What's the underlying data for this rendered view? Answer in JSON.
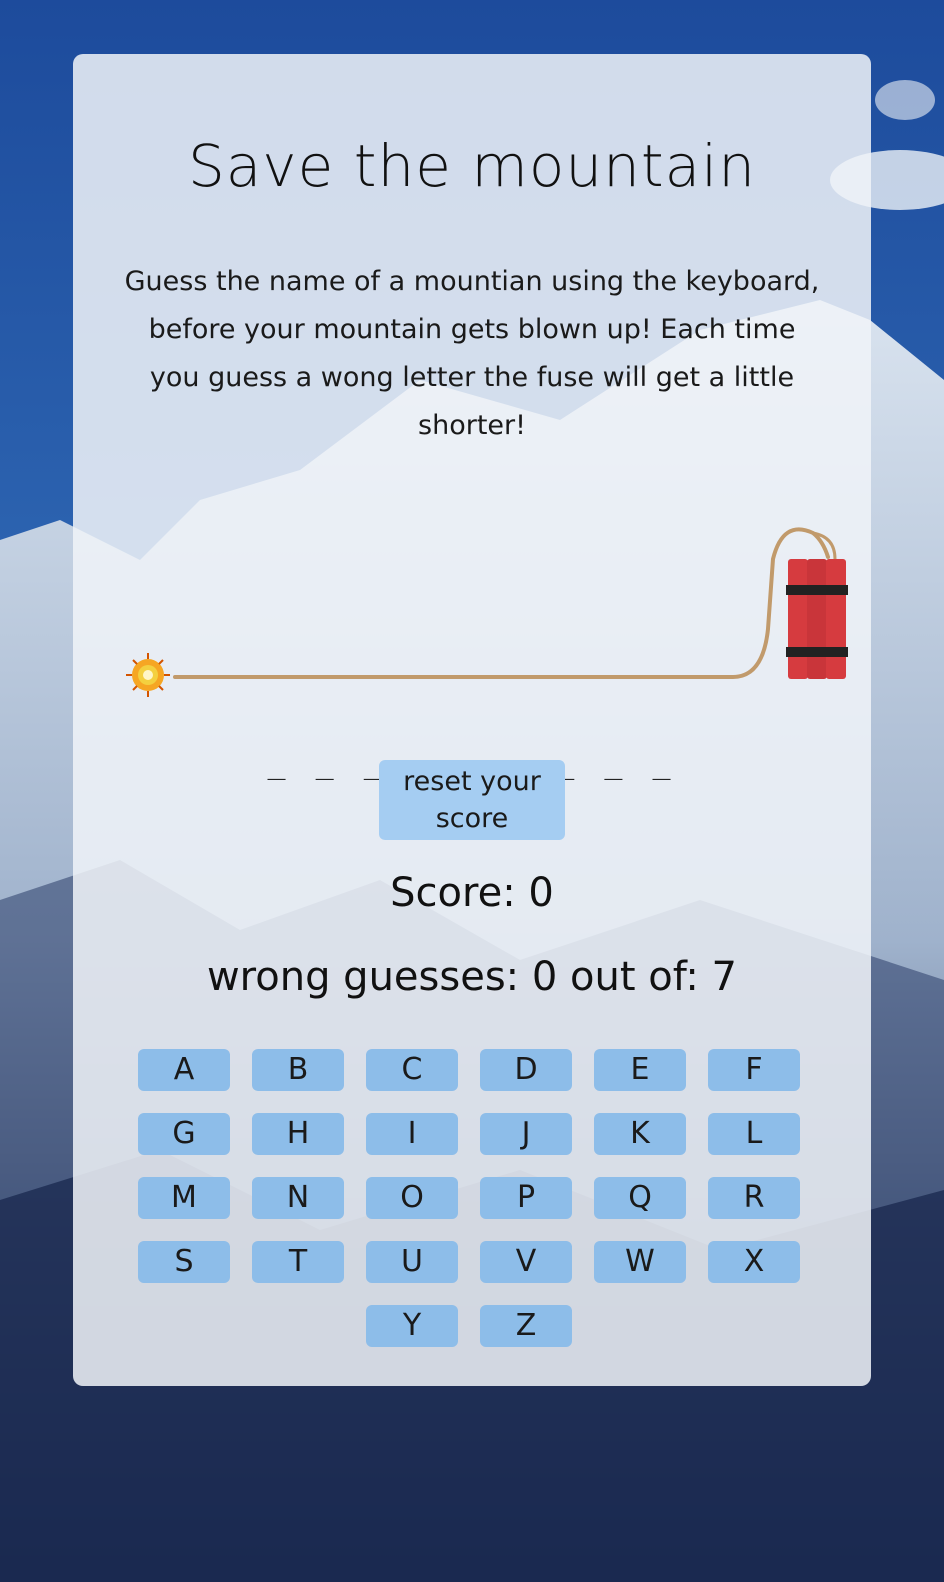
{
  "title": "Save the mountain",
  "intro": "Guess the name of a mountian using the keyboard, before your mountain gets blown up! Each time you guess a wong letter the fuse will get a little shorter!",
  "word_slots": "_ _ _ _ _ _ _ _ _",
  "reset_button": "reset your score",
  "score_text": "Score: 0",
  "wrong_text": "wrong guesses: 0 out of: 7",
  "keys": [
    "A",
    "B",
    "C",
    "D",
    "E",
    "F",
    "G",
    "H",
    "I",
    "J",
    "K",
    "L",
    "M",
    "N",
    "O",
    "P",
    "Q",
    "R",
    "S",
    "T",
    "U",
    "V",
    "W",
    "X",
    "Y",
    "Z"
  ],
  "colors": {
    "card_bg": "#f0f3f8",
    "key_bg": "#8dbde9",
    "reset_bg": "#a5cdf2",
    "fuse": "#c19a6b",
    "dynamite": "#d63b3f",
    "sky": "#1b4a9a"
  }
}
